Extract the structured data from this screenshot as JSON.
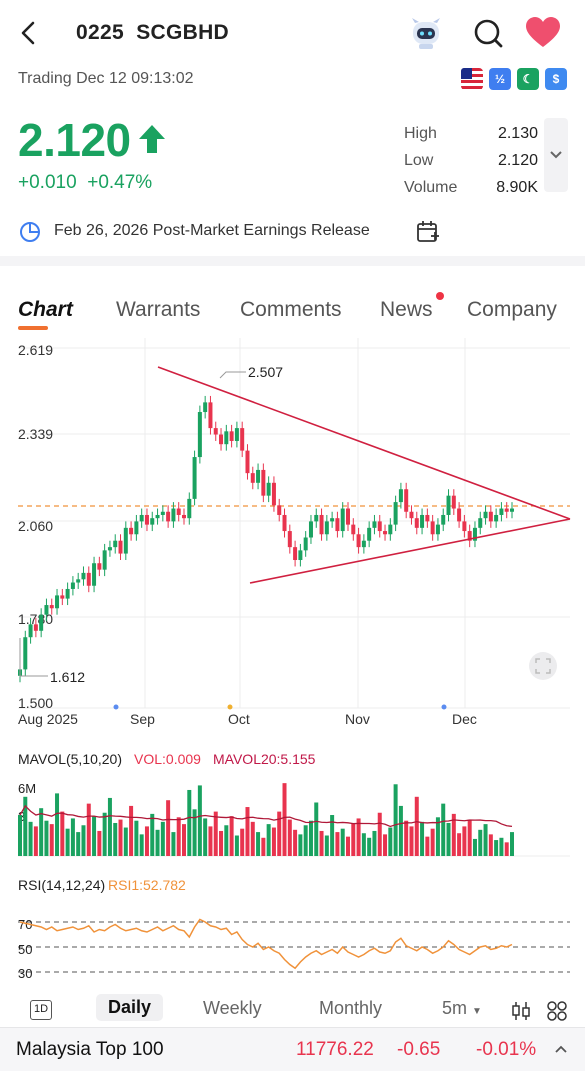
{
  "header": {
    "code": "0225",
    "name": "SCGBHD",
    "status": "Trading Dec 12 09:13:02"
  },
  "quote": {
    "price": "2.120",
    "change": "+0.010",
    "change_pct": "+0.47%",
    "high_label": "High",
    "high": "2.130",
    "low_label": "Low",
    "low": "2.120",
    "volume_label": "Volume",
    "volume": "8.90K"
  },
  "earnings": {
    "text": "Feb 26, 2026 Post-Market Earnings Release"
  },
  "tabs": [
    "Chart",
    "Warrants",
    "Comments",
    "News",
    "Company"
  ],
  "chart": {
    "y_ticks": [
      "2.619",
      "2.339",
      "2.060",
      "1.780",
      "1.500"
    ],
    "x_ticks": [
      "Aug 2025",
      "Sep",
      "Oct",
      "Nov",
      "Dec"
    ],
    "max_label": "2.507",
    "min_label": "1.612",
    "mavol_label": "MAVOL(5,10,20)",
    "vol_label": "VOL:0.009",
    "mavol20_label": "MAVOL20:5.155",
    "vol_axis": "6M",
    "vol_axis2": "3",
    "rsi_label": "RSI(14,12,24)",
    "rsi1_label": "RSI1:52.782",
    "rsi_ticks": [
      "70",
      "50",
      "30"
    ]
  },
  "chart_data": {
    "type": "candlestick",
    "title": "",
    "ylim": [
      1.5,
      2.619
    ],
    "last_price": 2.12,
    "high_marker": 2.507,
    "low_marker": 1.612,
    "x": [
      "Aug 2025",
      "Sep",
      "Oct",
      "Nov",
      "Dec"
    ],
    "close": [
      1.62,
      1.72,
      1.76,
      1.74,
      1.79,
      1.82,
      1.81,
      1.85,
      1.84,
      1.87,
      1.89,
      1.9,
      1.92,
      1.88,
      1.95,
      1.93,
      1.99,
      2.0,
      2.02,
      1.98,
      2.06,
      2.04,
      2.08,
      2.1,
      2.07,
      2.09,
      2.1,
      2.11,
      2.08,
      2.12,
      2.1,
      2.09,
      2.15,
      2.28,
      2.42,
      2.45,
      2.37,
      2.35,
      2.32,
      2.36,
      2.33,
      2.37,
      2.3,
      2.23,
      2.2,
      2.24,
      2.16,
      2.2,
      2.13,
      2.1,
      2.05,
      2.0,
      1.96,
      1.99,
      2.03,
      2.08,
      2.1,
      2.04,
      2.08,
      2.09,
      2.05,
      2.12,
      2.07,
      2.04,
      2.0,
      2.02,
      2.06,
      2.08,
      2.05,
      2.04,
      2.07,
      2.14,
      2.18,
      2.11,
      2.09,
      2.06,
      2.1,
      2.08,
      2.04,
      2.07,
      2.1,
      2.16,
      2.12,
      2.08,
      2.05,
      2.02,
      2.06,
      2.09,
      2.11,
      2.08,
      2.1,
      2.12,
      2.11,
      2.12
    ],
    "volume": [
      3.6,
      5.2,
      3,
      2.6,
      4.2,
      3.1,
      2.8,
      5.5,
      3.9,
      2.4,
      3.3,
      2.1,
      2.7,
      4.6,
      3.5,
      2.2,
      3.8,
      5.1,
      2.9,
      3.2,
      2.5,
      4.4,
      3.1,
      1.9,
      2.6,
      3.7,
      2.3,
      3,
      4.9,
      2.1,
      3.4,
      2.8,
      5.8,
      4.1,
      6.2,
      3.3,
      2.6,
      3.9,
      2.2,
      2.7,
      3.5,
      1.8,
      2.4,
      4.3,
      3,
      2.1,
      1.6,
      2.8,
      2.5,
      3.9,
      6.4,
      3.2,
      2.3,
      1.9,
      2.7,
      3.1,
      4.7,
      2.2,
      1.8,
      3.6,
      2.1,
      2.4,
      1.7,
      2.9,
      3.3,
      2,
      1.6,
      2.2,
      3.8,
      1.9,
      2.5,
      6.3,
      4.4,
      3.1,
      2.6,
      5.2,
      3,
      1.7,
      2.4,
      3.4,
      4.6,
      2.9,
      3.7,
      2,
      2.6,
      3.2,
      1.5,
      2.3,
      2.8,
      1.9,
      1.4,
      1.6,
      1.2,
      2.1
    ],
    "rsi": [
      70,
      69,
      68,
      67,
      66,
      64,
      66,
      63,
      64,
      65,
      66,
      64,
      65,
      67,
      62,
      64,
      63,
      66,
      68,
      65,
      63,
      64,
      65,
      63,
      62,
      64,
      66,
      63,
      65,
      67,
      64,
      63,
      58,
      66,
      72,
      70,
      67,
      66,
      64,
      65,
      60,
      62,
      56,
      52,
      50,
      53,
      48,
      50,
      47,
      45,
      40,
      36,
      33,
      38,
      42,
      45,
      47,
      44,
      46,
      48,
      45,
      50,
      46,
      44,
      42,
      44,
      47,
      49,
      46,
      45,
      47,
      54,
      57,
      51,
      49,
      47,
      50,
      48,
      45,
      47,
      50,
      55,
      52,
      48,
      46,
      44,
      47,
      50,
      51,
      48,
      49,
      51,
      50,
      52
    ]
  },
  "periods": [
    "1D",
    "Daily",
    "Weekly",
    "Monthly",
    "5m"
  ],
  "index_bar": {
    "name": "Malaysia Top 100",
    "value": "11776.22",
    "change": "-0.65",
    "change_pct": "-0.01%"
  },
  "colors": {
    "up": "#1aa260",
    "down": "#e8344e",
    "accent": "#f07030"
  }
}
